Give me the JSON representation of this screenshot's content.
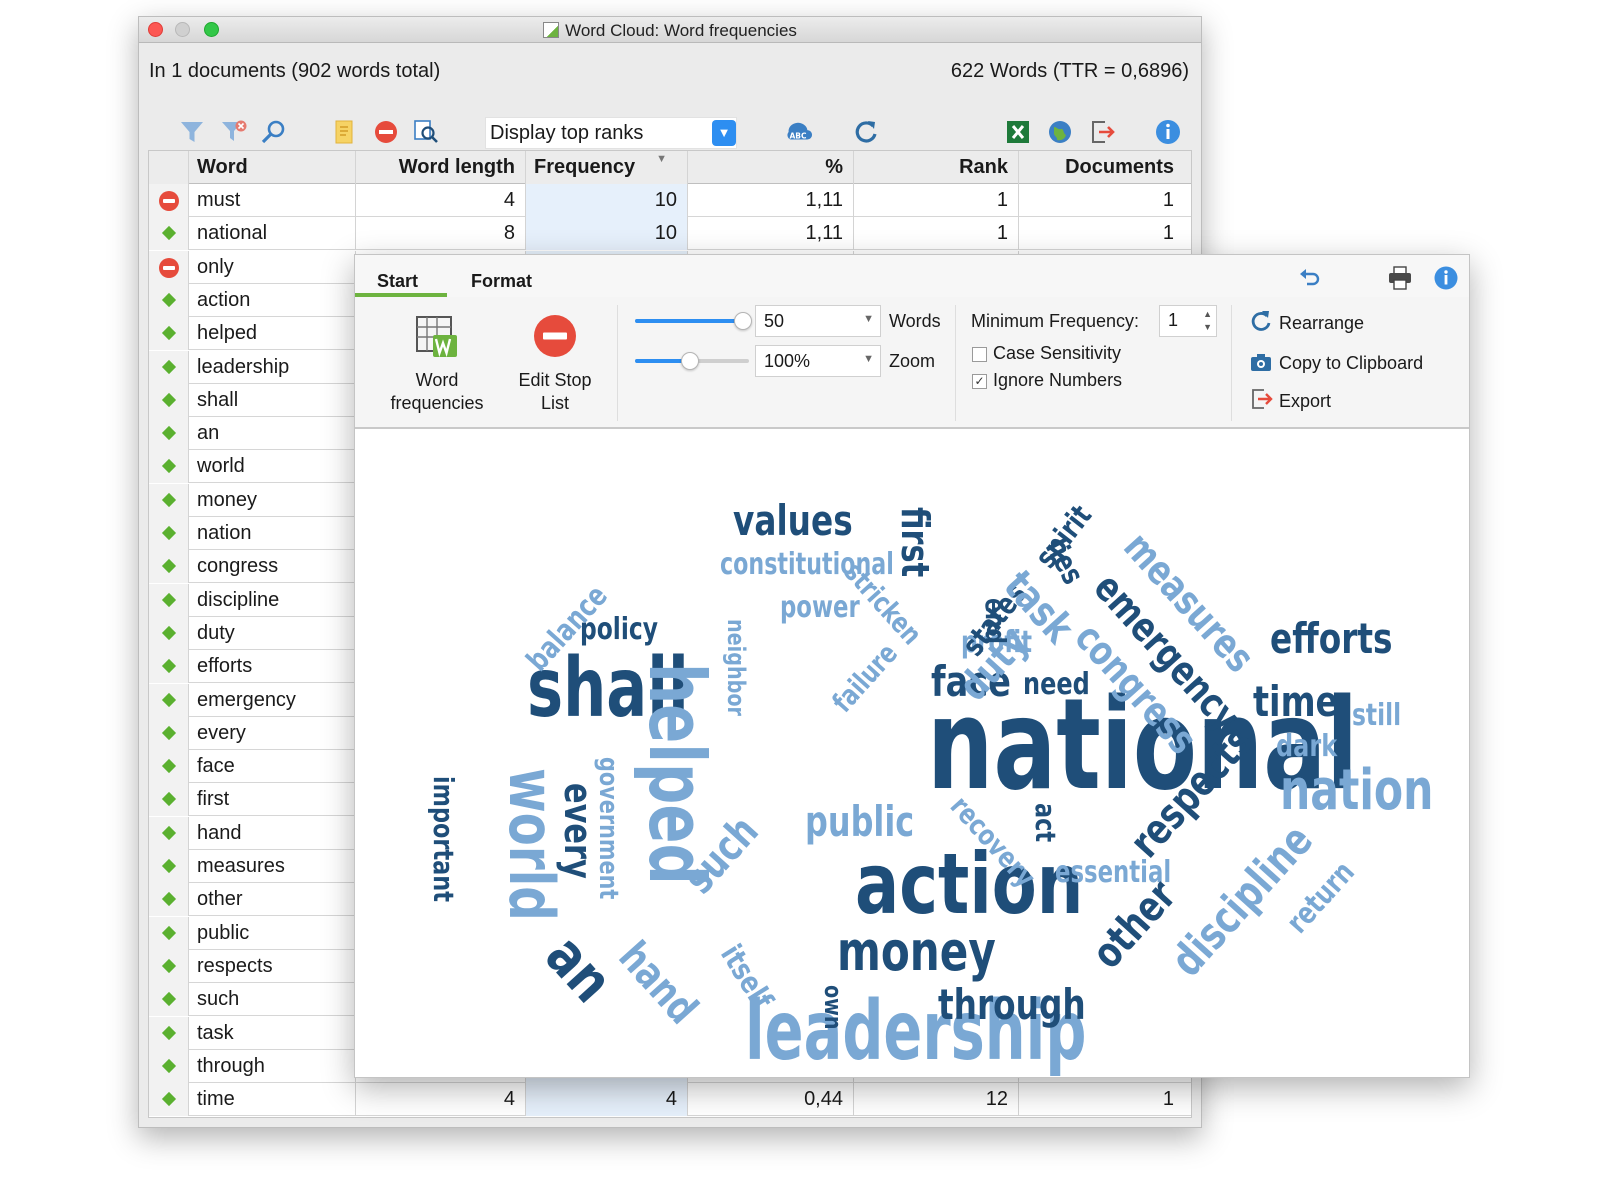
{
  "back_window": {
    "title": "Word Cloud: Word frequencies",
    "info_left": "In 1 documents  (902 words total)",
    "info_right": "622 Words (TTR = 0,6896)",
    "display_select": "Display top ranks",
    "toolbar_icons": [
      "filter-icon",
      "filter-clear-icon",
      "search-icon",
      "note-icon",
      "stop-icon",
      "inspect-icon",
      "spellcheck-icon",
      "refresh-icon",
      "excel-icon",
      "globe-icon",
      "export-icon",
      "info-icon"
    ],
    "columns": [
      "Word",
      "Word length",
      "Frequency",
      "%",
      "Rank",
      "Documents"
    ],
    "rows": [
      {
        "flag": "stop",
        "word": "must",
        "length": "4",
        "freq": "10",
        "pct": "1,11",
        "rank": "1",
        "docs": "1"
      },
      {
        "flag": "keep",
        "word": "national",
        "length": "8",
        "freq": "10",
        "pct": "1,11",
        "rank": "1",
        "docs": "1"
      },
      {
        "flag": "stop",
        "word": "only"
      },
      {
        "flag": "keep",
        "word": "action"
      },
      {
        "flag": "keep",
        "word": "helped"
      },
      {
        "flag": "keep",
        "word": "leadership"
      },
      {
        "flag": "keep",
        "word": "shall"
      },
      {
        "flag": "keep",
        "word": "an"
      },
      {
        "flag": "keep",
        "word": "world"
      },
      {
        "flag": "keep",
        "word": "money"
      },
      {
        "flag": "keep",
        "word": "nation"
      },
      {
        "flag": "keep",
        "word": "congress"
      },
      {
        "flag": "keep",
        "word": "discipline"
      },
      {
        "flag": "keep",
        "word": "duty"
      },
      {
        "flag": "keep",
        "word": "efforts"
      },
      {
        "flag": "keep",
        "word": "emergency"
      },
      {
        "flag": "keep",
        "word": "every"
      },
      {
        "flag": "keep",
        "word": "face"
      },
      {
        "flag": "keep",
        "word": "first"
      },
      {
        "flag": "keep",
        "word": "hand"
      },
      {
        "flag": "keep",
        "word": "measures"
      },
      {
        "flag": "keep",
        "word": "other"
      },
      {
        "flag": "keep",
        "word": "public"
      },
      {
        "flag": "keep",
        "word": "respects"
      },
      {
        "flag": "keep",
        "word": "such"
      },
      {
        "flag": "keep",
        "word": "task"
      },
      {
        "flag": "keep",
        "word": "through"
      },
      {
        "flag": "keep",
        "word": "time",
        "length": "4",
        "freq": "4",
        "pct": "0,44",
        "rank": "12",
        "docs": "1"
      }
    ]
  },
  "front_panel": {
    "tabs": {
      "start": "Start",
      "format": "Format"
    },
    "word_freq_label": "Word frequencies",
    "edit_stop_label": "Edit Stop List",
    "words_value": "50",
    "words_label": "Words",
    "words_level": 0.95,
    "zoom_value": "100%",
    "zoom_label": "Zoom",
    "zoom_level": 0.48,
    "min_freq_label": "Minimum Frequency:",
    "min_freq_value": "1",
    "case_sensitivity": {
      "label": "Case Sensitivity",
      "checked": false
    },
    "ignore_numbers": {
      "label": "Ignore Numbers",
      "checked": true
    },
    "rearrange_label": "Rearrange",
    "copy_label": "Copy to Clipboard",
    "export_label": "Export"
  },
  "colors": {
    "dark_blue": "#1f4e79",
    "mid_blue": "#2e6da4",
    "light_blue": "#7aa8d4",
    "accent_green": "#6db33f",
    "stop_red": "#e64b3c"
  },
  "word_cloud": [
    "national",
    "action",
    "leadership",
    "shall",
    "helped",
    "world",
    "money",
    "nation",
    "public",
    "values",
    "constitutional",
    "policy",
    "power",
    "face",
    "need",
    "profit",
    "efforts",
    "time",
    "still",
    "dark",
    "through",
    "essential",
    "balance",
    "neighbor",
    "failure",
    "duty",
    "first",
    "states",
    "spirit",
    "lies",
    "end",
    "stricken",
    "measures",
    "emergency",
    "task",
    "congress",
    "respects",
    "discipline",
    "return",
    "other",
    "an",
    "hand",
    "itself",
    "own",
    "such",
    "every",
    "government",
    "important",
    "recovery",
    "act"
  ]
}
